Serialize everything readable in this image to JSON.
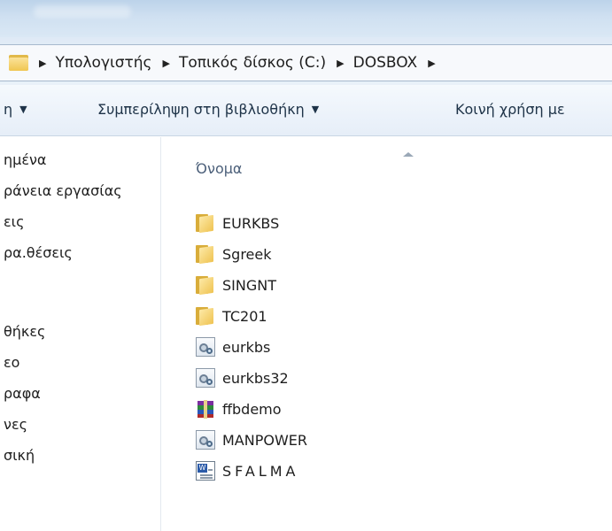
{
  "address": {
    "crumbs": [
      "Υπολογιστής",
      "Τοπικός δίσκος (C:)",
      "DOSBOX"
    ]
  },
  "toolbar": {
    "organize_label": "η",
    "include_label": "Συμπερίληψη στη βιβλιοθήκη",
    "share_label": "Κοινή χρήση με"
  },
  "nav": {
    "items": [
      "ημένα",
      "ράνεια εργασίας",
      "εις",
      "ρα.θέσεις",
      "θήκες",
      "εο",
      "ραφα",
      "νες",
      "σική"
    ]
  },
  "content": {
    "column_name": "Όνομα",
    "files": [
      {
        "name": "EURKBS",
        "icon": "folder-icon"
      },
      {
        "name": "Sgreek",
        "icon": "folder-icon"
      },
      {
        "name": "SINGNT",
        "icon": "folder-icon"
      },
      {
        "name": "TC201",
        "icon": "folder-icon"
      },
      {
        "name": "eurkbs",
        "icon": "exe-icon"
      },
      {
        "name": "eurkbs32",
        "icon": "exe-icon"
      },
      {
        "name": "ffbdemo",
        "icon": "winrar-archive-icon"
      },
      {
        "name": "MANPOWER",
        "icon": "exe-icon"
      },
      {
        "name": "SFALMA",
        "icon": "word-document-icon"
      }
    ]
  }
}
